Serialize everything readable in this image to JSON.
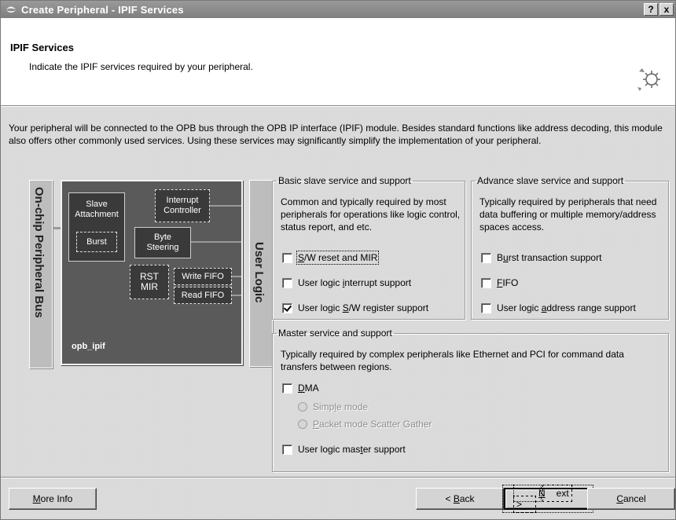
{
  "window": {
    "title": "Create Peripheral - IPIF Services",
    "help_label": "?",
    "close_label": "x"
  },
  "header": {
    "title": "IPIF Services",
    "subtitle": "Indicate the IPIF services required by your peripheral."
  },
  "intro": "Your peripheral will be connected to the OPB bus through the OPB IP interface (IPIF) module. Besides standard functions like address decoding, this module also offers other commonly used services. Using these services may significantly simplify the implementation of your peripheral.",
  "diagram": {
    "bus_label": "On-chip Peripheral Bus",
    "user_logic_label": "User Logic",
    "ipif_name": "opb_ipif",
    "slave_attachment": "Slave Attachment",
    "burst": "Burst",
    "interrupt_controller": "Interrupt Controller",
    "byte_steering": "Byte Steering",
    "rst_mir": "RST MIR",
    "write_fifo": "Write FIFO",
    "read_fifo": "Read FIFO"
  },
  "basic_slave": {
    "legend": "Basic slave service and support",
    "description": "Common and typically required by most peripherals for operations like logic control, status report, and etc.",
    "options": [
      {
        "pre": "",
        "key": "S",
        "post": "/W reset and MIR",
        "checked": false
      },
      {
        "pre": "User logic ",
        "key": "i",
        "post": "nterrupt support",
        "checked": false
      },
      {
        "pre": "User logic ",
        "key": "S",
        "post": "/W register support",
        "checked": true
      }
    ]
  },
  "advance_slave": {
    "legend": "Advance slave service and support",
    "description": "Typically required by peripherals that need data buffering or multiple memory/address spaces access.",
    "options": [
      {
        "pre": "B",
        "key": "u",
        "post": "rst transaction support",
        "checked": false
      },
      {
        "pre": "",
        "key": "F",
        "post": "IFO",
        "checked": false
      },
      {
        "pre": "User logic ",
        "key": "a",
        "post": "ddress range support",
        "checked": false
      }
    ]
  },
  "master": {
    "legend": "Master service and support",
    "description": "Typically required by complex peripherals like Ethernet and PCI for command data transfers between regions.",
    "dma": {
      "pre": "",
      "key": "D",
      "post": "MA",
      "checked": false
    },
    "simple_mode": {
      "pre": "Simp",
      "key": "l",
      "post": "e mode"
    },
    "packet_mode": {
      "pre": "",
      "key": "P",
      "post": "acket mode Scatter Gather"
    },
    "master_support": {
      "pre": "User logic mas",
      "key": "t",
      "post": "er support",
      "checked": false
    }
  },
  "buttons": {
    "more_info": {
      "pre": "",
      "key": "M",
      "post": "ore Info"
    },
    "back": {
      "pre": "< ",
      "key": "B",
      "post": "ack"
    },
    "next": {
      "pre": "",
      "key": "N",
      "post": "ext >"
    },
    "cancel": {
      "pre": "",
      "key": "C",
      "post": "ancel"
    }
  }
}
